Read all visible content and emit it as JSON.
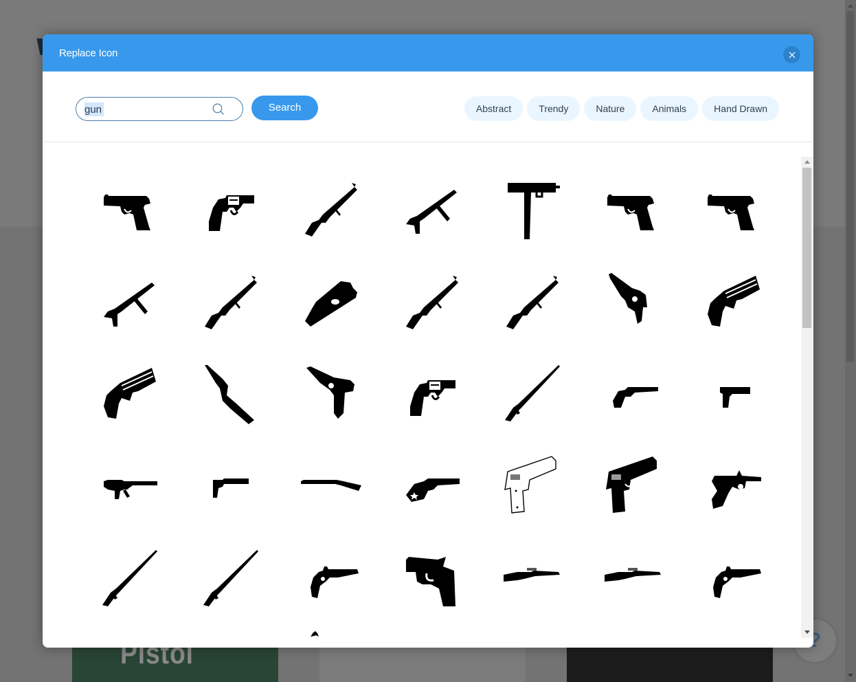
{
  "background": {
    "card_text": "Pistol"
  },
  "help_button": {
    "glyph": "?"
  },
  "modal": {
    "title": "Replace Icon",
    "close_label": "×"
  },
  "search": {
    "value": "gun",
    "placeholder": "",
    "button_label": "Search"
  },
  "categories": [
    "Abstract",
    "Trendy",
    "Nature",
    "Animals",
    "Hand Drawn"
  ],
  "icons": [
    {
      "name": "semi-auto-pistol",
      "shape": "pistol"
    },
    {
      "name": "snub-revolver",
      "shape": "revolver"
    },
    {
      "name": "ak-rifle",
      "shape": "rifle-diag"
    },
    {
      "name": "mp40-smg",
      "shape": "smg-diag"
    },
    {
      "name": "mac10-smg",
      "shape": "mac"
    },
    {
      "name": "walther-pistol",
      "shape": "pistol"
    },
    {
      "name": "glock-pistol",
      "shape": "pistol"
    },
    {
      "name": "uzi-smg",
      "shape": "smg-diag"
    },
    {
      "name": "assault-rifle",
      "shape": "rifle-diag"
    },
    {
      "name": "p90-smg",
      "shape": "bullpup"
    },
    {
      "name": "m16-rifle",
      "shape": "rifle-diag"
    },
    {
      "name": "tommy-gun",
      "shape": "rifle-diag"
    },
    {
      "name": "mauser-pistol",
      "shape": "mauser"
    },
    {
      "name": "derringer",
      "shape": "derringer"
    },
    {
      "name": "derringer-engraved",
      "shape": "derringer"
    },
    {
      "name": "broomhandle-carbine",
      "shape": "carbine-down"
    },
    {
      "name": "luger-pistol",
      "shape": "luger"
    },
    {
      "name": "revolver-detailed",
      "shape": "revolver"
    },
    {
      "name": "lever-action-rifle",
      "shape": "rifle-long"
    },
    {
      "name": "old-revolver",
      "shape": "small-revolver"
    },
    {
      "name": "small-pistol",
      "shape": "small-pistol"
    },
    {
      "name": "thompson-side",
      "shape": "smg-side"
    },
    {
      "name": "silenced-pistol",
      "shape": "silenced"
    },
    {
      "name": "shotgun",
      "shape": "shotgun"
    },
    {
      "name": "star-revolver",
      "shape": "star-revolver"
    },
    {
      "name": "colt-1911-outline",
      "shape": "colt-outline"
    },
    {
      "name": "colt-1911",
      "shape": "colt"
    },
    {
      "name": "luger-side",
      "shape": "luger-side"
    },
    {
      "name": "ar15-rifle",
      "shape": "rifle-long"
    },
    {
      "name": "battle-rifle",
      "shape": "rifle-long"
    },
    {
      "name": "flintlock-pistol",
      "shape": "flintlock"
    },
    {
      "name": "cartoon-gun",
      "shape": "cartoon"
    },
    {
      "name": "bolt-rifle",
      "shape": "bolt-rifle"
    },
    {
      "name": "scoped-rifle",
      "shape": "bolt-rifle"
    },
    {
      "name": "dueling-pistol",
      "shape": "flintlock"
    }
  ],
  "colors": {
    "accent": "#3899ec",
    "close_bg": "#2b81cb",
    "tag_bg": "#eaf6ff",
    "overlay": "#757575"
  }
}
